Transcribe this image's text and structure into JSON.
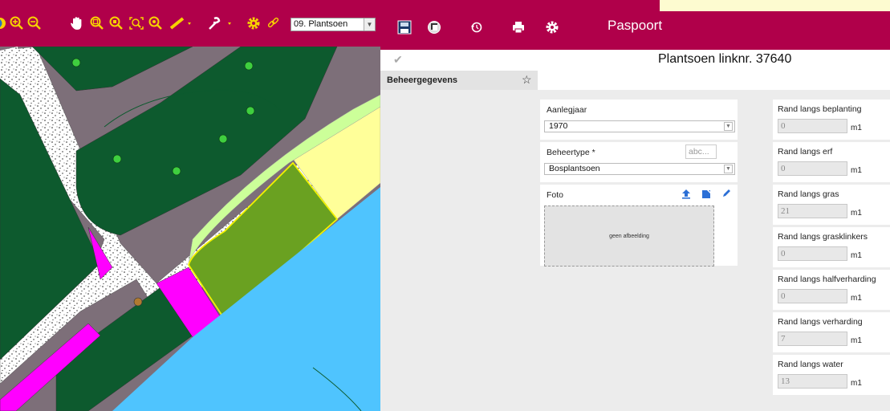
{
  "map_toolbar": {
    "icons": [
      "globe-icon",
      "zoom-in-icon",
      "zoom-out-icon",
      "pan-hand-icon",
      "zoom-box-in-icon",
      "zoom-box-out-icon",
      "zoom-extent-icon",
      "zoom-layer-icon",
      "measure-ruler-icon",
      "tools-wrench-icon",
      "settings-gear-icon",
      "link-icon"
    ],
    "layer_select": "09. Plantsoen",
    "color": "#b0004a"
  },
  "passport": {
    "title": "Paspoort",
    "header_icons": [
      "save-icon",
      "layers-icon",
      "history-icon",
      "print-icon",
      "settings-gear-icon"
    ],
    "record_title": "Plantsoen linknr. 37640",
    "tab": "Beheergegevens",
    "fields": {
      "aanlegjaar": {
        "label": "Aanlegjaar",
        "value": "1970"
      },
      "beheertype": {
        "label": "Beheertype *",
        "value": "Bosplantsoen",
        "placeholder": "abc..."
      },
      "foto": {
        "label": "Foto",
        "empty_text": "geen afbeelding"
      }
    },
    "edges": [
      {
        "label": "Rand langs beplanting",
        "value": "0",
        "unit": "m1"
      },
      {
        "label": "Rand langs erf",
        "value": "0",
        "unit": "m1"
      },
      {
        "label": "Rand langs gras",
        "value": "21",
        "unit": "m1"
      },
      {
        "label": "Rand langs grasklinkers",
        "value": "0",
        "unit": "m1"
      },
      {
        "label": "Rand langs halfverharding",
        "value": "0",
        "unit": "m1"
      },
      {
        "label": "Rand langs verharding",
        "value": "7",
        "unit": "m1"
      },
      {
        "label": "Rand langs water",
        "value": "13",
        "unit": "m1"
      }
    ]
  }
}
